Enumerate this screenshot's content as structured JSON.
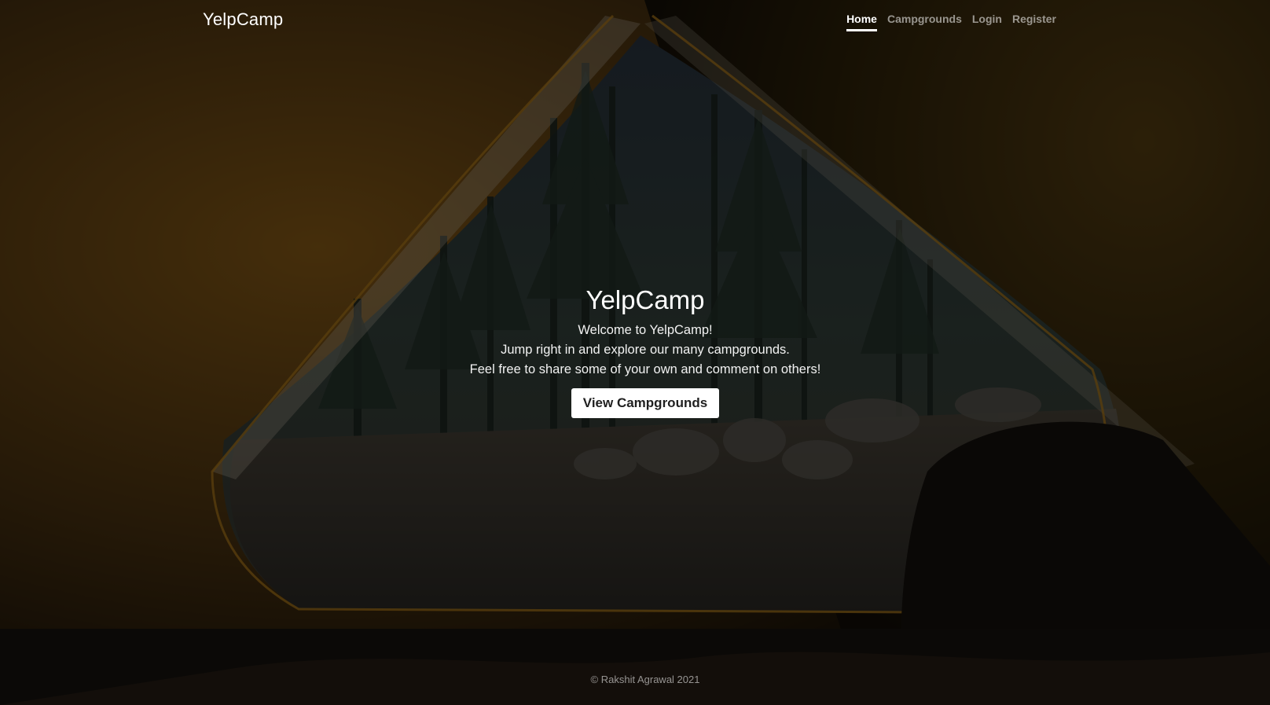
{
  "nav": {
    "brand": "YelpCamp",
    "links": [
      {
        "label": "Home",
        "active": true
      },
      {
        "label": "Campgrounds",
        "active": false
      },
      {
        "label": "Login",
        "active": false
      },
      {
        "label": "Register",
        "active": false
      }
    ]
  },
  "hero": {
    "title": "YelpCamp",
    "lines": [
      "Welcome to YelpCamp!",
      "Jump right in and explore our many campgrounds.",
      "Feel free to share some of your own and comment on others!"
    ],
    "button_label": "View Campgrounds"
  },
  "footer": {
    "text": "© Rakshit Agrawal 2021"
  },
  "colors": {
    "overlay": "#000000",
    "tent": "#7a5218",
    "forest": "#2e3b33",
    "text": "#ffffff"
  }
}
